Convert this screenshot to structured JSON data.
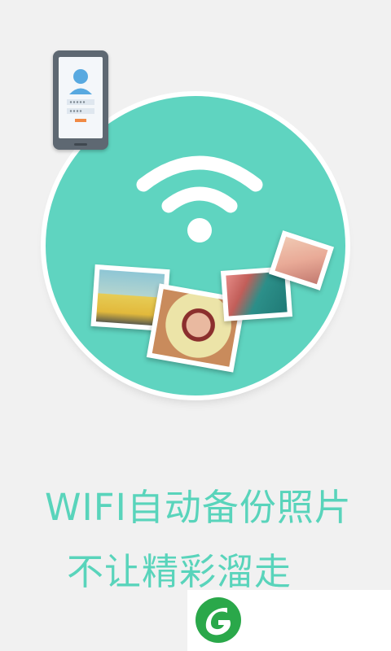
{
  "slogan": {
    "line1": "WIFI自动备份照片",
    "line2": "不让精彩溜走"
  },
  "icons": {
    "wifi": "wifi-icon",
    "phone": "phone-login-icon",
    "logo": "leaf-g-logo-icon"
  },
  "colors": {
    "background": "#f1f1f1",
    "circle": "#5fd4c0",
    "accent_text": "#59d4bb",
    "logo_green": "#2aa84a"
  }
}
